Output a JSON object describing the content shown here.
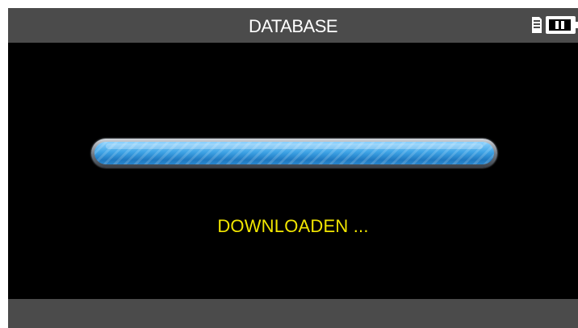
{
  "header": {
    "title": "DATABASE",
    "icons": [
      "sd-card-icon",
      "battery-icon"
    ]
  },
  "main": {
    "progress": {
      "fraction": 1.0
    },
    "status_text": "DOWNLOADEN ..."
  },
  "colors": {
    "bar_background": "#4b4b4b",
    "screen_background": "#000000",
    "status_text": "#f2e600",
    "progress_fill": "#3fa4e6"
  }
}
